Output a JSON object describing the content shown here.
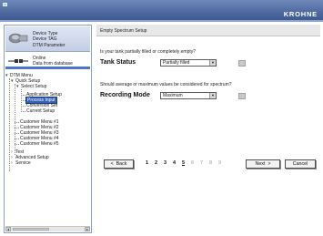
{
  "header": {
    "brand": "KROHNE"
  },
  "sidebar": {
    "device": {
      "line1": "Device Type",
      "line2": "Device TAG",
      "line3": "DTM Parameter"
    },
    "connection": {
      "line1": "Online",
      "line2": "Data from database"
    },
    "tree": {
      "dtm_menu": "DTM Menu",
      "quick_setup": "Quick Setup",
      "select_setup": "Select Setup",
      "application_setup": "Application Setup",
      "process_input": "Process Input",
      "conversion_set": "Conversion Set",
      "current_setup": "Current Setup",
      "customer_menu_1": "Customer Menu #1",
      "customer_menu_2": "Customer Menu #2",
      "customer_menu_3": "Customer Menu #3",
      "customer_menu_4": "Customer Menu #4",
      "customer_menu_5": "Customer Menu #5",
      "test": "Test",
      "advanced_setup": "Advanced Setup",
      "service": "Service"
    }
  },
  "main": {
    "title": "Empty Spectrum Setup",
    "q1": "Is your tank partially filled or completely empty?",
    "tank_status_label": "Tank Status",
    "tank_status_value": "Partially filled",
    "q2": "Should average or maximum values be considered for spectrum?",
    "recording_mode_label": "Recording Mode",
    "recording_mode_value": "Maximum",
    "back_label": "Back",
    "next_label": "Next",
    "cancel_label": "Cancel",
    "pages": [
      "1",
      "2",
      "3",
      "4",
      "5",
      "6",
      "7",
      "8",
      "9"
    ],
    "current_page": "5"
  }
}
